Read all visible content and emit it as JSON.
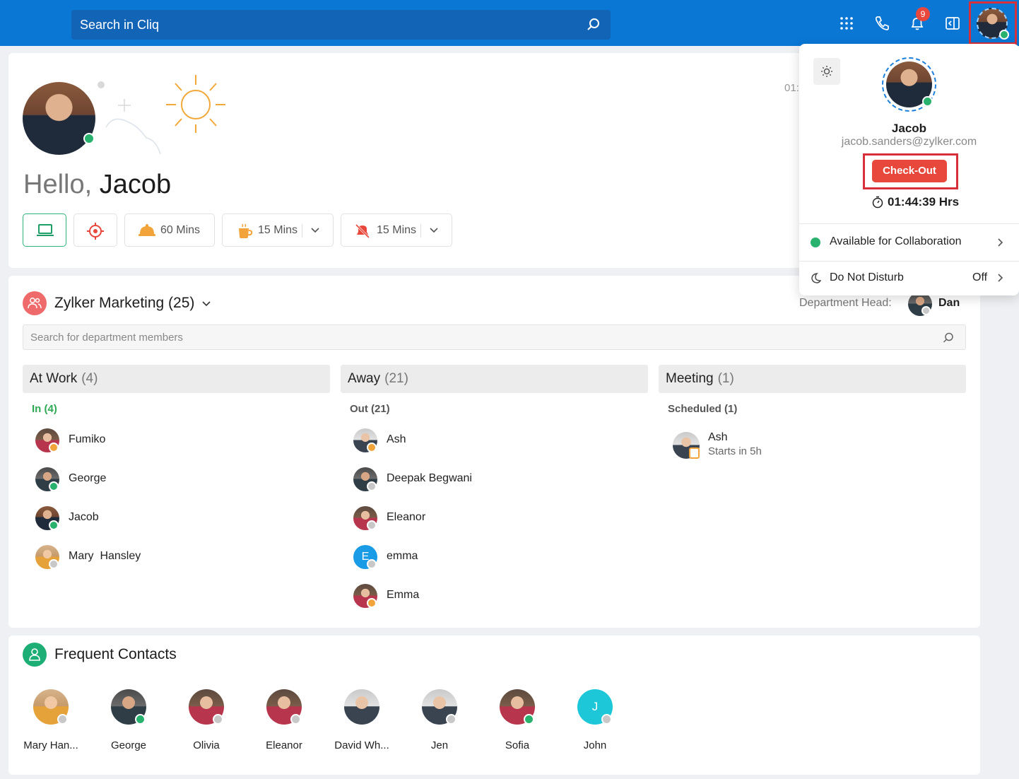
{
  "topbar": {
    "search_placeholder": "Search in Cliq",
    "notification_count": "9",
    "icons": [
      "apps-grid-icon",
      "phone-icon",
      "bell-icon",
      "sidebar-toggle-icon",
      "profile-avatar"
    ]
  },
  "greeting": {
    "hello": "Hello,",
    "name": "Jacob",
    "clock_partial": "01:"
  },
  "quick_actions": [
    {
      "icon": "laptop-icon",
      "label": ""
    },
    {
      "icon": "target-icon",
      "label": ""
    },
    {
      "icon": "meal-cloche-icon",
      "label": "60 Mins"
    },
    {
      "icon": "coffee-cup-icon",
      "label": "15 Mins"
    },
    {
      "icon": "bell-off-icon",
      "label": "15 Mins"
    }
  ],
  "department": {
    "title": "Zylker Marketing (25)",
    "head_label": "Department Head:",
    "head_name": "Dan",
    "search_placeholder": "Search for department members",
    "columns": [
      {
        "title": "At Work",
        "count": "(4)",
        "group": "In (4)",
        "members": [
          {
            "name": "Fumiko",
            "status": "orange"
          },
          {
            "name": "George",
            "status": "green"
          },
          {
            "name": "Jacob",
            "status": "green"
          },
          {
            "name": "Mary  Hansley",
            "status": "grey"
          }
        ]
      },
      {
        "title": "Away",
        "count": "(21)",
        "group": "Out (21)",
        "members": [
          {
            "name": "Ash",
            "status": "orange"
          },
          {
            "name": "Deepak Begwani",
            "status": "grey"
          },
          {
            "name": "Eleanor",
            "status": "grey"
          },
          {
            "name": "emma",
            "status": "grey",
            "initial": "E"
          },
          {
            "name": "Emma",
            "status": "orange"
          }
        ]
      },
      {
        "title": "Meeting",
        "count": "(1)",
        "group": "Scheduled (1)",
        "members": [
          {
            "name": "Ash",
            "sub": "Starts in 5h",
            "status": "calendar"
          }
        ]
      }
    ]
  },
  "frequent_contacts": {
    "title": "Frequent Contacts",
    "contacts": [
      {
        "name": "Mary Han...",
        "status": "grey"
      },
      {
        "name": "George",
        "status": "green"
      },
      {
        "name": "Olivia",
        "status": "grey"
      },
      {
        "name": "Eleanor",
        "status": "grey"
      },
      {
        "name": "David Wh...",
        "status": "none"
      },
      {
        "name": "Jen",
        "status": "grey"
      },
      {
        "name": "Sofia",
        "status": "green"
      },
      {
        "name": "John",
        "status": "grey",
        "initial": "J"
      }
    ]
  },
  "profile_popover": {
    "name": "Jacob",
    "email": "jacob.sanders@zylker.com",
    "checkout_label": "Check-Out",
    "timer": "01:44:39 Hrs",
    "status_label": "Available for Collaboration",
    "dnd_label": "Do Not Disturb",
    "dnd_value": "Off"
  },
  "colors": {
    "topbar": "#0a77d5",
    "checkout": "#e8473b",
    "online": "#28b26e",
    "away": "#f2a33a",
    "offline": "#c8c8c8",
    "dept_icon": "#ef6b6b",
    "contacts_icon": "#1cae74"
  }
}
